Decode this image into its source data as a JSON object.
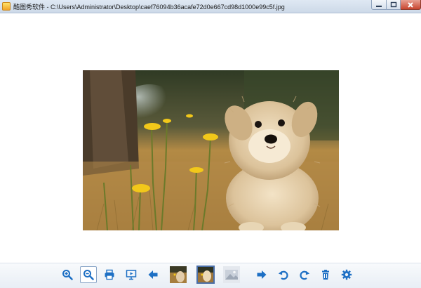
{
  "window": {
    "title": "酷图秀软件 - C:\\Users\\Administrator\\Desktop\\caef76094b36acafe72d0e667cd98d1000e99c5f.jpg",
    "icon": "app-icon"
  },
  "viewer": {
    "image_subject": "fluffy cream puppy sitting in dry grass with yellow flowers"
  },
  "toolbar": {
    "buttons": [
      {
        "icon": "zoom-in-icon"
      },
      {
        "icon": "zoom-out-icon",
        "active": true
      },
      {
        "icon": "print-icon"
      },
      {
        "icon": "slideshow-icon"
      },
      {
        "icon": "arrow-left-icon"
      },
      {
        "icon": "thumbnail-prev"
      },
      {
        "icon": "thumbnail-current",
        "selected": true
      },
      {
        "icon": "thumbnail-next-placeholder"
      },
      {
        "icon": "arrow-right-icon"
      },
      {
        "icon": "rotate-left-icon"
      },
      {
        "icon": "rotate-right-icon"
      },
      {
        "icon": "delete-icon"
      },
      {
        "icon": "settings-gear-icon"
      }
    ]
  },
  "colors": {
    "accent_blue": "#1d6fc4",
    "titlebar": "#dfe8f3",
    "close_red": "#c8452f"
  }
}
